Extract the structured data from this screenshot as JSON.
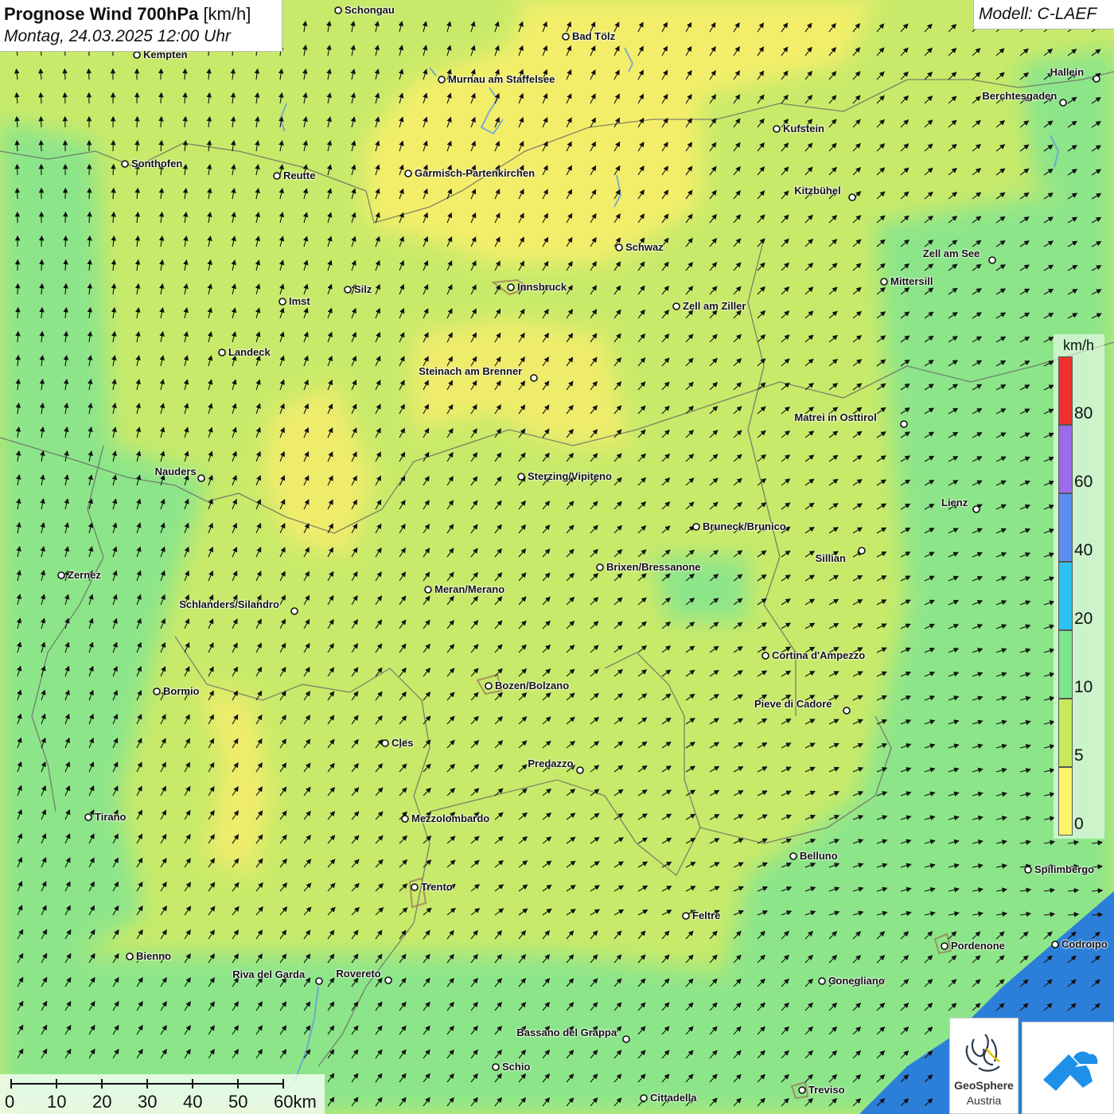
{
  "header": {
    "title_bold": "Prognose Wind 700hPa",
    "title_unit": "[km/h]",
    "subtitle": "Montag, 24.03.2025 12:00 Uhr",
    "model": "Modell: C-LAEF"
  },
  "legend": {
    "unit": "km/h",
    "bands": [
      {
        "label": "0",
        "color": "#fdf46a"
      },
      {
        "label": "5",
        "color": "#c8ea5a"
      },
      {
        "label": "10",
        "color": "#7ee58f"
      },
      {
        "label": "20",
        "color": "#2cc3f0"
      },
      {
        "label": "40",
        "color": "#5b8ef0"
      },
      {
        "label": "60",
        "color": "#9a6bea"
      },
      {
        "label": "80",
        "color": "#f03030"
      }
    ]
  },
  "scale_bar": {
    "labels": [
      "0",
      "10",
      "20",
      "30",
      "40",
      "50",
      "60km"
    ]
  },
  "cities": [
    {
      "name": "Schongau"
    },
    {
      "name": "Bad Tölz"
    },
    {
      "name": "Kempten"
    },
    {
      "name": "Murnau am Staffelsee"
    },
    {
      "name": "Hallein"
    },
    {
      "name": "Berchtesgaden"
    },
    {
      "name": "Kufstein"
    },
    {
      "name": "Sonthofen"
    },
    {
      "name": "Reutte"
    },
    {
      "name": "Garmisch-Partenkirchen"
    },
    {
      "name": "Kitzbühel"
    },
    {
      "name": "Schwaz"
    },
    {
      "name": "Zell am See"
    },
    {
      "name": "Mittersill"
    },
    {
      "name": "Innsbruck"
    },
    {
      "name": "Silz"
    },
    {
      "name": "Imst"
    },
    {
      "name": "Zell am Ziller"
    },
    {
      "name": "Landeck"
    },
    {
      "name": "Steinach am Brenner"
    },
    {
      "name": "Matrei in Osttirol"
    },
    {
      "name": "Nauders"
    },
    {
      "name": "Sterzing/Vipiteno"
    },
    {
      "name": "Lienz"
    },
    {
      "name": "Bruneck/Brunico"
    },
    {
      "name": "Sillian"
    },
    {
      "name": "Zernez"
    },
    {
      "name": "Brixen/Bressanone"
    },
    {
      "name": "Meran/Merano"
    },
    {
      "name": "Schlanders/Silandro"
    },
    {
      "name": "Cortina d'Ampezzo"
    },
    {
      "name": "Bormio"
    },
    {
      "name": "Bozen/Bolzano"
    },
    {
      "name": "Pieve di Cadore"
    },
    {
      "name": "Cles"
    },
    {
      "name": "Predazzo"
    },
    {
      "name": "Tirano"
    },
    {
      "name": "Mezzolombardo"
    },
    {
      "name": "Belluno"
    },
    {
      "name": "Spilimbergo"
    },
    {
      "name": "Trento"
    },
    {
      "name": "Feltre"
    },
    {
      "name": "Pordenone"
    },
    {
      "name": "Codroipo"
    },
    {
      "name": "Bienno"
    },
    {
      "name": "Riva del Garda"
    },
    {
      "name": "Rovereto"
    },
    {
      "name": "Conegliano"
    },
    {
      "name": "Bassano del Grappa"
    },
    {
      "name": "Schio"
    },
    {
      "name": "Treviso"
    },
    {
      "name": "Cittadella"
    }
  ],
  "logos": {
    "geosphere_line1": "GeoSphere",
    "geosphere_line2": "Austria"
  }
}
